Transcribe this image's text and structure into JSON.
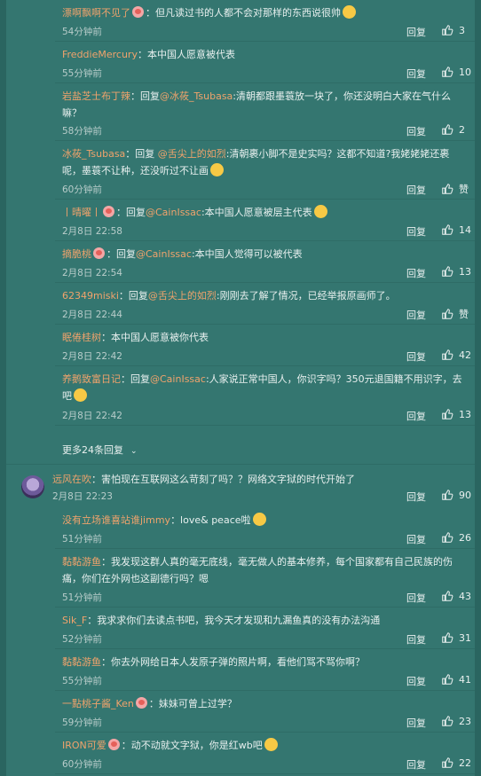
{
  "actions": {
    "reply_label": "回复"
  },
  "top_replies": [
    {
      "user": "漂啊飘啊不见了",
      "text": "：但凡读过书的人都不会对那样的东西说很帅",
      "badge": true,
      "emoji": true,
      "time": "54分钟前",
      "likes": "3"
    },
    {
      "user": "FreddieMercury",
      "text": "：本中国人愿意被代表",
      "time": "55分钟前",
      "likes": "10"
    },
    {
      "user": "岩盐芝士布丁辣",
      "prefix": "：回复",
      "mention": "@冰莜_Tsubasa",
      "text": ":清朝都跟墨蓑放一块了，你还没明白大家在气什么嘛？",
      "time": "58分钟前",
      "likes": "2"
    },
    {
      "user": "冰莜_Tsubasa",
      "prefix": "：回复 ",
      "mention": "@舌尖上的如烈",
      "text": ":清朝裹小脚不是史实吗？这都不知道?我姥姥姥还裹呢，墨蓑不让种，还没听过不让画",
      "emoji": true,
      "time": "60分钟前",
      "likes": "赞"
    },
    {
      "user": "丨晴曜丨",
      "badge": true,
      "prefix": "：回复",
      "mention": "@CainIssac",
      "text": ":本中国人愿意被层主代表",
      "emoji": true,
      "time": "2月8日 22:58",
      "likes": "14"
    },
    {
      "user": "摘脆桃",
      "badge": true,
      "prefix": "：回复",
      "mention": "@CainIssac",
      "text": ":本中国人觉得可以被代表",
      "time": "2月8日 22:54",
      "likes": "13"
    },
    {
      "user": "62349miski",
      "prefix": "：回复",
      "mention": "@舌尖上的如烈",
      "text": ":刚刚去了解了情况，已经举报原画师了。",
      "time": "2月8日 22:44",
      "likes": "赞"
    },
    {
      "user": "眠倦桂树",
      "text": "：本中国人愿意被你代表",
      "time": "2月8日 22:42",
      "likes": "42"
    },
    {
      "user": "养鹅致富日记",
      "prefix": "：回复",
      "mention": "@CainIssac",
      "text": ":人家说正常中国人，你识字吗？350元退国籍不用识字，去吧",
      "emoji": true,
      "time": "2月8日 22:42",
      "likes": "13"
    }
  ],
  "more_replies": "更多24条回复",
  "main_comment": {
    "user": "远风在吹",
    "text": "：害怕现在互联网这么苛刻了吗？？网络文字狱的时代开始了",
    "time": "2月8日 22:23",
    "likes": "90"
  },
  "sub_replies": [
    {
      "user": "没有立场谁喜站谁jimmy",
      "text": "：love& peace啦",
      "emoji": true,
      "time": "51分钟前",
      "likes": "26"
    },
    {
      "user": "黏黏游鱼",
      "text": "：我发现这群人真的毫无底线，毫无做人的基本修养，每个国家都有自己民族的伤痛，你们在外网也这副德行吗？嗯",
      "time": "51分钟前",
      "likes": "43"
    },
    {
      "user": "Sik_F",
      "text": "：我求求你们去读点书吧，我今天才发现和九漏鱼真的没有办法沟通",
      "time": "52分钟前",
      "likes": "31"
    },
    {
      "user": "黏黏游鱼",
      "text": "：你去外网给日本人发原子弹的照片啊，看他们骂不骂你啊？",
      "time": "55分钟前",
      "likes": "41"
    },
    {
      "user": "一點桃子酱_Ken",
      "badge": true,
      "text": "：妹妹可曾上过学？",
      "time": "59分钟前",
      "likes": "23"
    },
    {
      "user": "IRON可爱",
      "badge": true,
      "text": "：动不动就文字狱，你是红wb吧",
      "emoji": true,
      "time": "60分钟前",
      "likes": "22"
    }
  ]
}
